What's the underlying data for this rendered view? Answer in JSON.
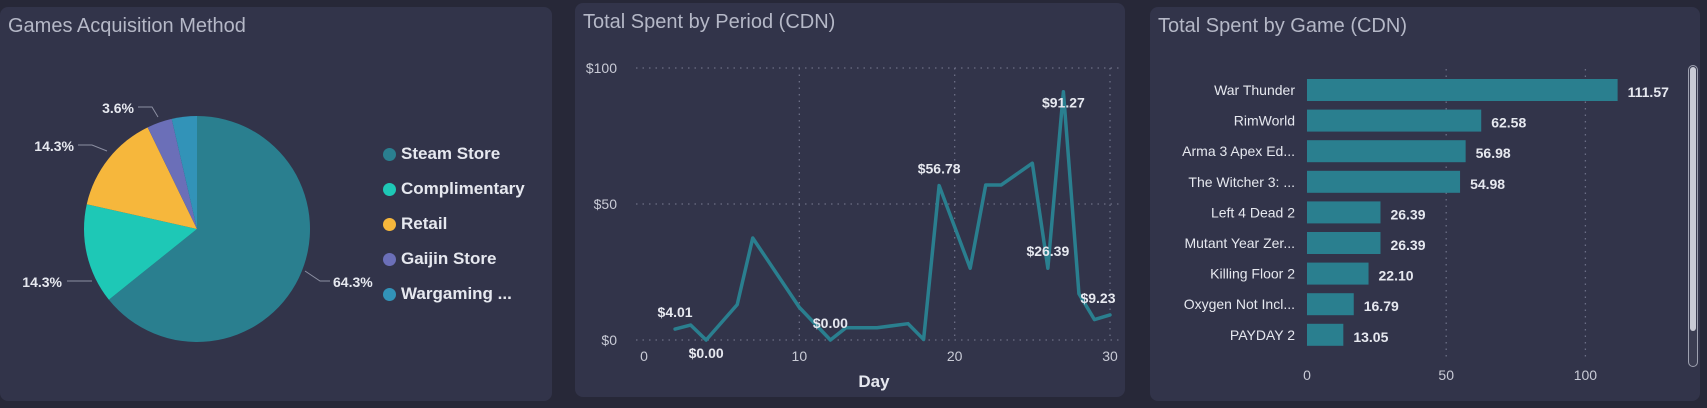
{
  "colors": {
    "background": "#272838",
    "panel": "#32344a",
    "title": "#b5b8c7",
    "label": "#e6e8ef",
    "axis": "#c9cbd6",
    "grid": "#6b6e85",
    "line": "#2a7f8f",
    "bar": "#2a7f8f"
  },
  "panels": {
    "acquisition": {
      "title": "Games Acquisition Method"
    },
    "period": {
      "title": "Total Spent by Period (CDN)"
    },
    "game": {
      "title": "Total Spent by Game (CDN)"
    }
  },
  "chart_data": [
    {
      "type": "pie",
      "title": "Games Acquisition Method",
      "legend_position": "right",
      "slices": [
        {
          "name": "Steam Store",
          "value": 64.3,
          "label": "64.3%",
          "color": "#2a7f8f"
        },
        {
          "name": "Complimentary",
          "value": 14.3,
          "label": "14.3%",
          "color": "#1ec8b6"
        },
        {
          "name": "Retail",
          "value": 14.3,
          "label": "14.3%",
          "color": "#f6b73c"
        },
        {
          "name": "Gaijin Store",
          "value": 3.6,
          "label": "3.6%",
          "color": "#6b6fb8"
        },
        {
          "name": "Wargaming ...",
          "value": 3.6,
          "label": "",
          "color": "#3293b8"
        }
      ]
    },
    {
      "type": "line",
      "title": "Total Spent by Period (CDN)",
      "xlabel": "Day",
      "ylabel": "",
      "xlim": [
        0,
        30
      ],
      "ylim": [
        0,
        100
      ],
      "xticks": [
        "0",
        "10",
        "20",
        "30"
      ],
      "yticks": [
        "$0",
        "$50",
        "$100"
      ],
      "grid": true,
      "x": [
        2,
        3,
        4,
        6,
        7,
        10,
        12,
        13,
        15,
        17,
        18,
        19,
        21,
        22,
        23,
        25,
        26,
        27,
        28,
        29,
        30
      ],
      "y": [
        4.01,
        5.5,
        0.0,
        13,
        37.5,
        12,
        0.0,
        4.5,
        4.5,
        6,
        0.2,
        56.78,
        26.39,
        57,
        57,
        65,
        26.39,
        91.27,
        17,
        7.5,
        9.23
      ],
      "data_labels": [
        {
          "index": 0,
          "text": "$4.01"
        },
        {
          "index": 2,
          "text": "$0.00"
        },
        {
          "index": 6,
          "text": "$0.00"
        },
        {
          "index": 11,
          "text": "$56.78"
        },
        {
          "index": 16,
          "text": "$26.39"
        },
        {
          "index": 17,
          "text": "$91.27"
        },
        {
          "index": 20,
          "text": "$9.23"
        }
      ]
    },
    {
      "type": "bar",
      "orientation": "horizontal",
      "title": "Total Spent by Game (CDN)",
      "xlim": [
        0,
        125
      ],
      "xticks": [
        "0",
        "50",
        "100"
      ],
      "grid": true,
      "categories": [
        "War Thunder",
        "RimWorld",
        "Arma 3 Apex Ed...",
        "The Witcher 3: ...",
        "Left 4 Dead 2",
        "Mutant Year Zer...",
        "Killing Floor 2",
        "Oxygen Not Incl...",
        "PAYDAY 2"
      ],
      "values": [
        111.57,
        62.58,
        56.98,
        54.98,
        26.39,
        26.39,
        22.1,
        16.79,
        13.05
      ],
      "value_labels": [
        "111.57",
        "62.58",
        "56.98",
        "54.98",
        "26.39",
        "26.39",
        "22.10",
        "16.79",
        "13.05"
      ]
    }
  ]
}
